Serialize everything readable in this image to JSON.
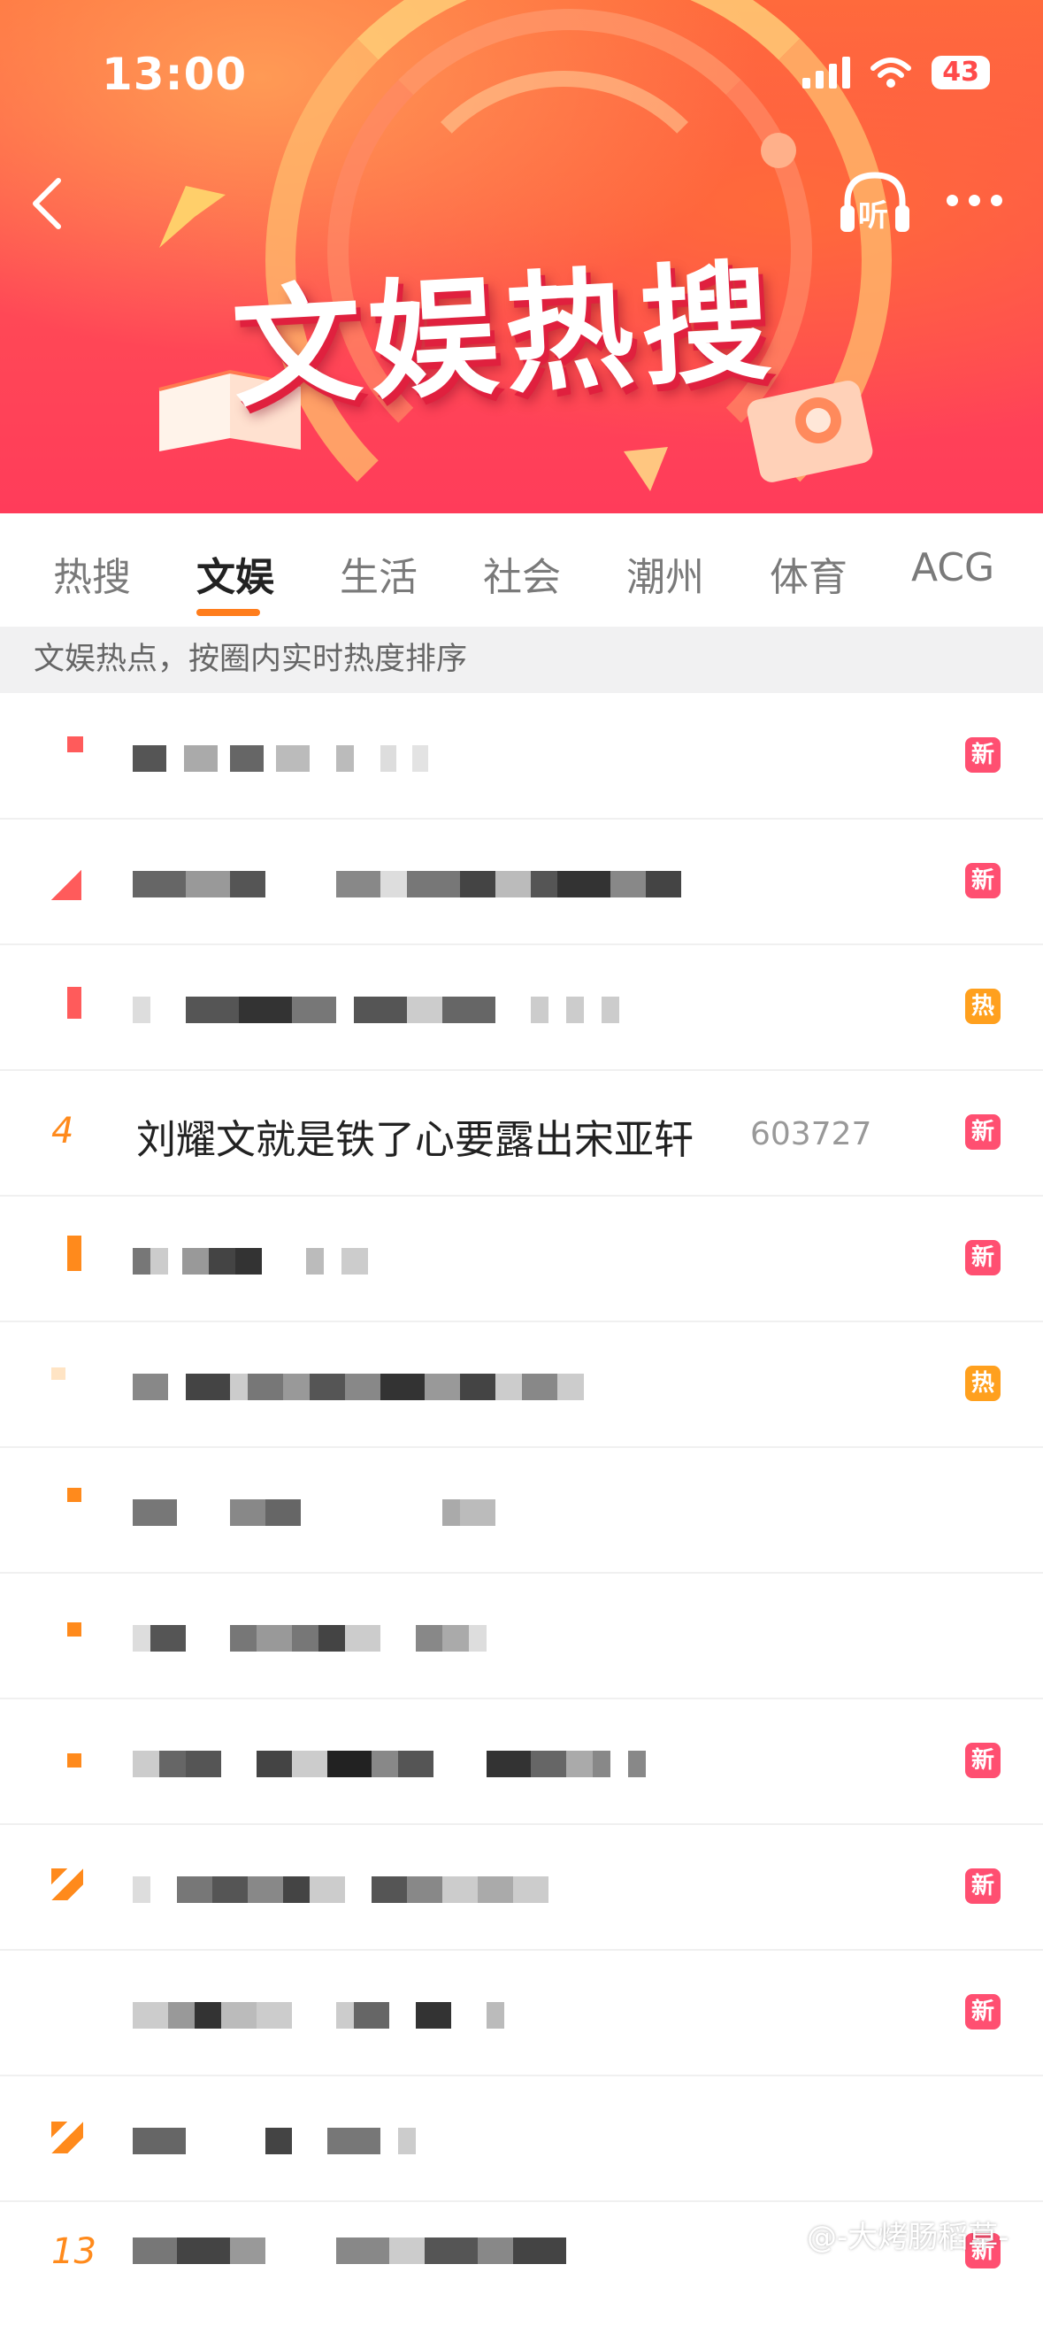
{
  "status_bar": {
    "time": "13:00",
    "battery": "43"
  },
  "header": {
    "title": "文娱热搜",
    "listen_label": "听"
  },
  "tabs": [
    {
      "label": "热搜"
    },
    {
      "label": "文娱"
    },
    {
      "label": "生活"
    },
    {
      "label": "社会"
    },
    {
      "label": "潮州"
    },
    {
      "label": "体育"
    },
    {
      "label": "ACG"
    }
  ],
  "active_tab": "文娱",
  "subtitle": "文娱热点，按圈内实时热度排序",
  "items": [
    {
      "rank": "",
      "title": "",
      "count": "",
      "badge": "新"
    },
    {
      "rank": "",
      "title": "",
      "count": "",
      "badge": "新"
    },
    {
      "rank": "",
      "title": "",
      "count": "",
      "badge": "热"
    },
    {
      "rank": "4",
      "title": "刘耀文就是铁了心要露出宋亚轩",
      "count": "603727",
      "badge": "新"
    },
    {
      "rank": "",
      "title": "",
      "count": "",
      "badge": "新"
    },
    {
      "rank": "",
      "title": "",
      "count": "",
      "badge": "热"
    },
    {
      "rank": "",
      "title": "",
      "count": "",
      "badge": ""
    },
    {
      "rank": "",
      "title": "",
      "count": "",
      "badge": ""
    },
    {
      "rank": "",
      "title": "",
      "count": "",
      "badge": "新"
    },
    {
      "rank": "",
      "title": "",
      "count": "",
      "badge": "新"
    },
    {
      "rank": "",
      "title": "",
      "count": "",
      "badge": "新"
    },
    {
      "rank": "",
      "title": "",
      "count": "",
      "badge": ""
    },
    {
      "rank": "13",
      "title": "",
      "count": "",
      "badge": "新"
    }
  ],
  "watermark": "@-大烤肠稻草-",
  "colors": {
    "badge_new": "#ff4f71",
    "badge_hot": "#ffa01e",
    "accent": "#ff7d1c",
    "rank": "#ff8a1c"
  },
  "icons": [
    "back-icon",
    "headphones-icon",
    "more-icon",
    "signal-icon",
    "wifi-icon",
    "battery-icon"
  ]
}
